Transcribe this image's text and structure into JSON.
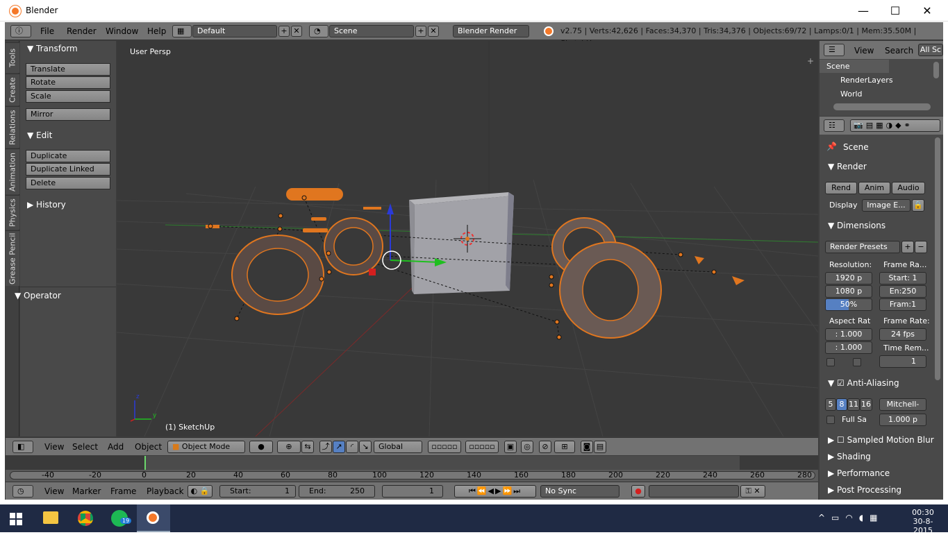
{
  "window": {
    "title": "Blender",
    "minimize": "—",
    "maximize": "☐",
    "close": "✕"
  },
  "info": {
    "menus": [
      "File",
      "Render",
      "Window",
      "Help"
    ],
    "screen_layout": "Default",
    "scene": "Scene",
    "engine": "Blender Render",
    "stats": "v2.75 | Verts:42,626 | Faces:34,370 | Tris:34,376 | Objects:69/72 | Lamps:0/1 | Mem:35.50M | SketchUp"
  },
  "tabs": [
    "Tools",
    "Create",
    "Relations",
    "Animation",
    "Physics",
    "Grease Pencil"
  ],
  "toolshelf": {
    "transform": {
      "title": "Transform",
      "buttons": [
        "Translate",
        "Rotate",
        "Scale"
      ],
      "mirror": "Mirror"
    },
    "edit": {
      "title": "Edit",
      "buttons": [
        "Duplicate",
        "Duplicate Linked",
        "Delete"
      ]
    },
    "history": "History",
    "operator": "Operator"
  },
  "viewport": {
    "label": "User Persp",
    "object_label": "(1) SketchUp",
    "axis_x": "y",
    "axis_z": "z"
  },
  "v3d_header": {
    "menus": [
      "View",
      "Select",
      "Add",
      "Object"
    ],
    "mode": "Object Mode",
    "orientation": "Global"
  },
  "timeline": {
    "ticks": [
      "-40",
      "-20",
      "0",
      "20",
      "40",
      "60",
      "80",
      "100",
      "120",
      "140",
      "160",
      "180",
      "200",
      "220",
      "240",
      "260",
      "280"
    ],
    "current_frame_marker": 0
  },
  "timeline_header": {
    "menus": [
      "View",
      "Marker",
      "Frame",
      "Playback"
    ],
    "start_label": "Start:",
    "start": "1",
    "end_label": "End:",
    "end": "250",
    "current": "1",
    "sync": "No Sync"
  },
  "outliner": {
    "view": "View",
    "search": "Search",
    "all": "All Sc",
    "items": [
      "Scene",
      "RenderLayers",
      "World"
    ]
  },
  "properties": {
    "scene": "Scene",
    "render": {
      "title": "Render",
      "rend": "Rend",
      "anim": "Anim",
      "audio": "Audio",
      "display_label": "Display",
      "display": "Image E..."
    },
    "dimensions": {
      "title": "Dimensions",
      "presets": "Render Presets",
      "resolution": "Resolution:",
      "res_x": "1920 p",
      "res_y": "1080 p",
      "res_pct": "50%",
      "frame_range": "Frame Ra...",
      "start": "Start: 1",
      "end": "En:250",
      "step": "Fram:1",
      "aspect": "Aspect Rat",
      "aspect_x": ": 1.000",
      "aspect_y": ": 1.000",
      "frame_rate": "Frame Rate:",
      "fps": "24 fps",
      "time_rem": "Time Rem...",
      "time_val": "1"
    },
    "aa": {
      "title": "Anti-Aliasing",
      "samples": [
        "5",
        "8",
        "11",
        "16"
      ],
      "filter": "Mitchell-",
      "full": "Full Sa",
      "size": "1.000 p"
    },
    "motion_blur": "Sampled Motion Blur",
    "shading": "Shading",
    "performance": "Performance",
    "post": "Post Processing"
  },
  "taskbar": {
    "time": "00:30",
    "date": "30-8-2015",
    "badge": "19"
  }
}
